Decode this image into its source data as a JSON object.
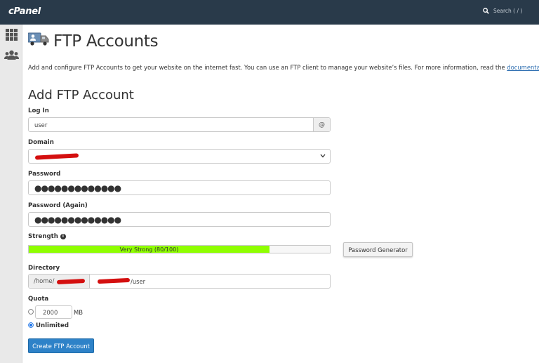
{
  "header": {
    "brand": "cPanel",
    "search_placeholder": "Search ( / )"
  },
  "sidebar": {
    "items": [
      {
        "icon": "grid-icon"
      },
      {
        "icon": "users-icon"
      }
    ]
  },
  "page": {
    "title": "FTP Accounts",
    "intro": "Add and configure FTP Accounts to get your website on the internet fast. You can use an FTP client to manage your website’s files. For more information, read the",
    "intro_link": "documentation",
    "intro_end": "."
  },
  "form": {
    "section_title": "Add FTP Account",
    "login_label": "Log In",
    "login_value": "user",
    "login_addon": "@",
    "domain_label": "Domain",
    "domain_value": "",
    "password_label": "Password",
    "password_value": "●●●●●●●●●●●●●",
    "password_again_label": "Password (Again)",
    "password_again_value": "●●●●●●●●●●●●●",
    "strength_label": "Strength",
    "strength_text": "Very Strong (80/100)",
    "strength_score": 80,
    "strength_color": "#8fff00",
    "password_generator_label": "Password Generator",
    "directory_label": "Directory",
    "directory_prefix": "/home/",
    "directory_value": "/user",
    "quota_label": "Quota",
    "quota_value": "2000",
    "quota_unit": "MB",
    "unlimited_label": "Unlimited",
    "quota_selected": "Unlimited",
    "create_label": "Create FTP Account"
  },
  "colors": {
    "topbar": "#293a4a",
    "primary_button": "#2e82c8",
    "link": "#2f6fb1",
    "redaction": "#d40f0f"
  }
}
